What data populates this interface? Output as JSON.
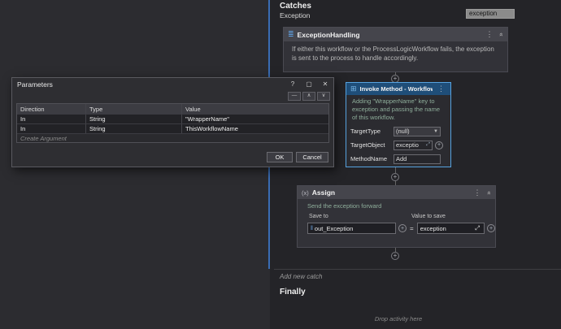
{
  "icons": {
    "sequence": "≣",
    "invoke": "⊞",
    "assign": "(x)",
    "dots": "⋮",
    "collapse": "»",
    "plus": "+",
    "chevron_down": "▼",
    "expand": "⤢",
    "vb": "‖"
  },
  "canvas": {
    "catches_label": "Catches",
    "exception_label": "Exception",
    "exception_value": "exception",
    "add_new_catch": "Add new catch",
    "finally_label": "Finally",
    "drop_hint": "Drop activity here"
  },
  "exception_handling": {
    "title": "ExceptionHandling",
    "description": "If either this workflow or the ProcessLogicWorkflow fails, the exception is sent to the  process to handle accordingly."
  },
  "invoke_method": {
    "title": "Invoke Method - Workflowname",
    "annotation": "Adding \"WrapperName\" key  to exception and passing the name of this workflow.",
    "target_type_label": "TargetType",
    "target_type_value": "(null)",
    "target_object_label": "TargetObject",
    "target_object_value": "exceptio",
    "method_name_label": "MethodName",
    "method_name_value": "Add"
  },
  "assign": {
    "title": "Assign",
    "annotation": "Send the exception forward",
    "save_to_label": "Save to",
    "value_to_save_label": "Value to save",
    "save_to_value": "out_Exception",
    "equals": "=",
    "value_to_save_value": "exception"
  },
  "parameters_dialog": {
    "title": "Parameters",
    "window_buttons": {
      "help": "?",
      "maximize": "▢",
      "close": "✕"
    },
    "toolbar": {
      "remove": "—",
      "up": "∧",
      "down": "∨"
    },
    "columns": [
      "Direction",
      "Type",
      "Value"
    ],
    "rows": [
      {
        "direction": "In",
        "type": "String",
        "value": "\"WrapperName\""
      },
      {
        "direction": "In",
        "type": "String",
        "value": "ThisWorkflowName"
      }
    ],
    "create_row": "Create Argument",
    "ok": "OK",
    "cancel": "Cancel"
  }
}
